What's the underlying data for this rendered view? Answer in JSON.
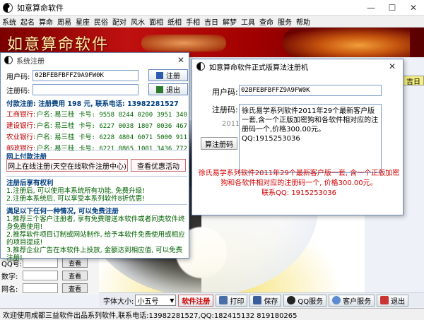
{
  "main": {
    "title": "如意算命软件",
    "menu": [
      "系统",
      "起名",
      "算命",
      "周易",
      "星座",
      "民俗",
      "配对",
      "风水",
      "面相",
      "纸相",
      "手相",
      "吉日",
      "解梦",
      "工具",
      "查命",
      "服务",
      "帮助"
    ],
    "banner_title": "如意算命软件",
    "left_panel": {
      "rows": [
        {
          "label": "QQ号:",
          "button": "查看"
        },
        {
          "label": "数字:",
          "button": "查看"
        },
        {
          "label": "网名:",
          "button": "查看"
        }
      ]
    },
    "toolbar": {
      "font_size_label": "字体大小:",
      "font_size_value": "小五号",
      "buttons": [
        "软件注册",
        "打印",
        "保存",
        "QQ服务",
        "客户服务",
        "退出"
      ]
    },
    "status": "欢迎使用成都三益软件出品系列软件,联系电话:13982281527,QQ:182415132 819180265",
    "date_fragment": "吉日"
  },
  "dialog1": {
    "title": "系统注册",
    "user_code_label": "用户码:",
    "user_code_value": "02BFEBFBFFZ9A9FW0K",
    "reg_code_label": "注册码:",
    "reg_code_value": "",
    "register_button": "注册",
    "exit_button": "退出",
    "pay_header": "付款注册: 注册费用 198 元, 联系电话: 13982281527",
    "banks": [
      {
        "bank": "工商银行:",
        "payee": "户名: 易三桂",
        "card": "卡号: 9558 8244 0200 3951 340"
      },
      {
        "bank": "建设银行:",
        "payee": "户名: 易三桂",
        "card": "卡号: 6227 0038 1807 0036 467"
      },
      {
        "bank": "农业银行:",
        "payee": "户名: 易三桂",
        "card": "卡号: 6228 4804 6071 5000 911"
      },
      {
        "bank": "邮政银行:",
        "payee": "户名: 易三桂",
        "card": "卡号: 6221 8865 1001 3436 772"
      }
    ],
    "online_header": "网上付款注册",
    "online_button": "网上在线注册(天空在线软件注册中心)",
    "promo_button": "查看优惠活动",
    "rights_header": "注册后享有权利",
    "rights": [
      "1.注册后, 可以使用本系统所有功能, 免费升级!",
      "2.注册本系统后, 可以享受本系列软件8折优惠!"
    ],
    "free_header": "满足以下任何一种情况, 可以免费注册",
    "free_items": [
      "1.推荐三个客户注册者, 享有免费赠送本软件或者同类软件终身免费使用!",
      "2.推荐软件项目订制或网站制作, 给予本软件免费使用或相应的项目提成!",
      "3.推荐企业广告在本软件上投放, 金额达到相应值, 可以免费注册!"
    ]
  },
  "dialog2": {
    "title": "如意算命软件正式版算法注册机",
    "user_code_label": "用户码:",
    "user_code_value": "02BFEBFBFFZ9A9FW0K",
    "reg_code_label": "注册码:",
    "reg_code_value": "徐氏易学系列软件2011年29个最新客户版一套,含一个正版加密狗和各软件相对应的注册码一个,价格300.00元。QQ:1915253036",
    "year_label": "2011",
    "generate_button": "算注册码",
    "ad_text": "徐氏易学系列软件2011年29个最新客户版一套, 含一个正版加密狗和各软件相对应的注册码一个, 价格300.00元。",
    "ad_qq": "联系QQ: 1915253036"
  }
}
